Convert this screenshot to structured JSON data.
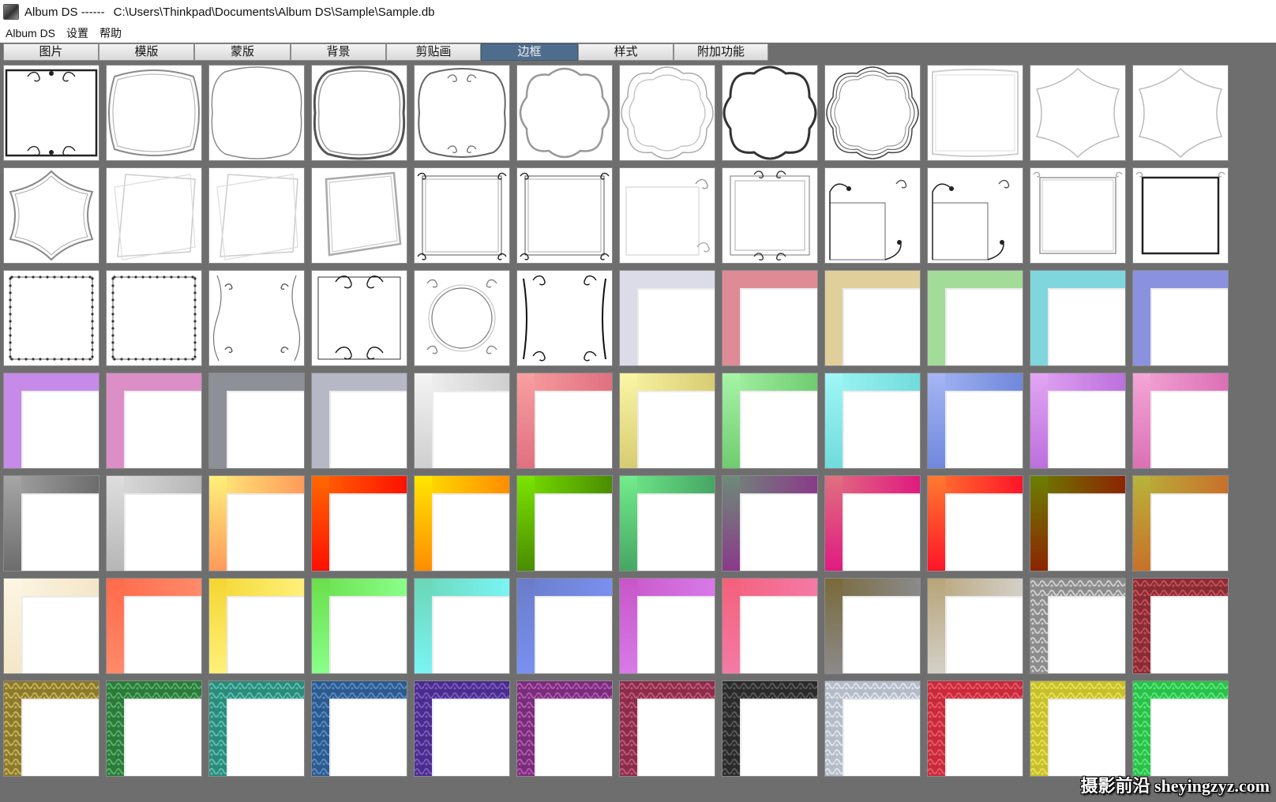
{
  "window": {
    "title": "Album DS ------",
    "path": "C:\\Users\\Thinkpad\\Documents\\Album DS\\Sample\\Sample.db",
    "icon": "album-app-icon"
  },
  "menu": [
    {
      "label": "Album DS"
    },
    {
      "label": "设置"
    },
    {
      "label": "帮助"
    }
  ],
  "tabs": [
    {
      "label": "图片"
    },
    {
      "label": "模版"
    },
    {
      "label": "蒙版"
    },
    {
      "label": "背景"
    },
    {
      "label": "剪贴画"
    },
    {
      "label": "边框"
    },
    {
      "label": "样式"
    },
    {
      "label": "附加功能"
    }
  ],
  "active_tab": 5,
  "grid": {
    "rows": 7,
    "cols": 12
  },
  "frames": [
    {
      "kind": "ornate-scroll"
    },
    {
      "kind": "scalloped-light"
    },
    {
      "kind": "arched-light"
    },
    {
      "kind": "arched-double"
    },
    {
      "kind": "arched-ornate"
    },
    {
      "kind": "cloud"
    },
    {
      "kind": "cloud-double"
    },
    {
      "kind": "cloud-bold"
    },
    {
      "kind": "cloud-triple"
    },
    {
      "kind": "plain-light"
    },
    {
      "kind": "diamond-light"
    },
    {
      "kind": "diamond-light"
    },
    {
      "kind": "diamond-double"
    },
    {
      "kind": "rotated-square"
    },
    {
      "kind": "rotated-square"
    },
    {
      "kind": "rotated-square-double"
    },
    {
      "kind": "corner-ornaments"
    },
    {
      "kind": "corner-ornaments"
    },
    {
      "kind": "corner-swirl-light"
    },
    {
      "kind": "lace-frame"
    },
    {
      "kind": "vine-box"
    },
    {
      "kind": "vine-box"
    },
    {
      "kind": "pinned-square"
    },
    {
      "kind": "pinned-square-bold"
    },
    {
      "kind": "floral-border"
    },
    {
      "kind": "floral-border-dense"
    },
    {
      "kind": "vine-sides"
    },
    {
      "kind": "baroque-bold"
    },
    {
      "kind": "circle-lace"
    },
    {
      "kind": "branch-bold"
    },
    {
      "kind": "solid-corner",
      "color": "#dcdce8"
    },
    {
      "kind": "solid-corner",
      "color": "#de8b96"
    },
    {
      "kind": "solid-corner",
      "color": "#e0cf9a"
    },
    {
      "kind": "solid-corner",
      "color": "#a2dc98"
    },
    {
      "kind": "solid-corner",
      "color": "#7fd6dc"
    },
    {
      "kind": "solid-corner",
      "color": "#8a92e0"
    },
    {
      "kind": "solid-corner",
      "color": "#c68ae8"
    },
    {
      "kind": "solid-corner",
      "color": "#dc8ec6"
    },
    {
      "kind": "solid-corner",
      "color": "#8e9098"
    },
    {
      "kind": "solid-corner",
      "color": "#b6b8c6"
    },
    {
      "kind": "gradient-corner",
      "color": "#f4f4f4",
      "color2": "#cfcfcf"
    },
    {
      "kind": "gradient-corner",
      "color": "#f8a0a0",
      "color2": "#e07080"
    },
    {
      "kind": "gradient-corner",
      "color": "#faf6a6",
      "color2": "#d8cc72"
    },
    {
      "kind": "gradient-corner",
      "color": "#a6f4a6",
      "color2": "#70cc70"
    },
    {
      "kind": "gradient-corner",
      "color": "#a0f6f6",
      "color2": "#70dcdc"
    },
    {
      "kind": "gradient-corner",
      "color": "#a6b6f4",
      "color2": "#7088dc"
    },
    {
      "kind": "gradient-corner",
      "color": "#e2a6f4",
      "color2": "#bc70dc"
    },
    {
      "kind": "gradient-corner",
      "color": "#f4a6d6",
      "color2": "#dc70b6"
    },
    {
      "kind": "gradient-corner",
      "color": "#a6a6a6",
      "color2": "#6c6c6c"
    },
    {
      "kind": "gradient-corner",
      "color": "#dedede",
      "color2": "#b6b6b6"
    },
    {
      "kind": "gradient-corner",
      "color": "#fff07a",
      "color2": "#ff9a5a"
    },
    {
      "kind": "gradient-corner",
      "color": "#ff6a00",
      "color2": "#ff1000"
    },
    {
      "kind": "gradient-corner",
      "color": "#ffe600",
      "color2": "#ff8c00"
    },
    {
      "kind": "gradient-corner",
      "color": "#7ae400",
      "color2": "#4a8c00"
    },
    {
      "kind": "gradient-corner",
      "color": "#72ec8c",
      "color2": "#46a664"
    },
    {
      "kind": "gradient-corner",
      "color": "#6e8a78",
      "color2": "#8a3a8a"
    },
    {
      "kind": "gradient-corner",
      "color": "#e07080",
      "color2": "#e01a80"
    },
    {
      "kind": "gradient-corner",
      "color": "#ff7a30",
      "color2": "#ff1428"
    },
    {
      "kind": "gradient-corner",
      "color": "#6a8000",
      "color2": "#8c2400"
    },
    {
      "kind": "gradient-corner",
      "color": "#b8b43a",
      "color2": "#c8702a"
    },
    {
      "kind": "gradient-corner",
      "color": "#fdf6e4",
      "color2": "#f4e6c8"
    },
    {
      "kind": "gradient-corner",
      "color": "#ff6a4a",
      "color2": "#ff8a6a"
    },
    {
      "kind": "gradient-corner",
      "color": "#f4d632",
      "color2": "#fff07a"
    },
    {
      "kind": "gradient-corner",
      "color": "#6ade4a",
      "color2": "#8aff8a"
    },
    {
      "kind": "gradient-corner",
      "color": "#6ad6b6",
      "color2": "#7af4f4"
    },
    {
      "kind": "gradient-corner",
      "color": "#6a7cc8",
      "color2": "#7a90f0"
    },
    {
      "kind": "gradient-corner",
      "color": "#c856c8",
      "color2": "#d87ae8"
    },
    {
      "kind": "gradient-corner",
      "color": "#f4607a",
      "color2": "#f47aa6"
    },
    {
      "kind": "gradient-corner",
      "color": "#7a6a3a",
      "color2": "#8a8a8a"
    },
    {
      "kind": "gradient-corner",
      "color": "#b8a478",
      "color2": "#d4d0c8"
    },
    {
      "kind": "texture-corner",
      "color": "#8c8c8c",
      "color2": "#cfcfcf"
    },
    {
      "kind": "texture-corner",
      "color": "#8a2c34",
      "color2": "#c4505a"
    },
    {
      "kind": "texture-corner",
      "color": "#8c7a2c",
      "color2": "#c8b25a"
    },
    {
      "kind": "texture-corner",
      "color": "#2c7a3a",
      "color2": "#5ab06a"
    },
    {
      "kind": "texture-corner",
      "color": "#2c8a7a",
      "color2": "#5ac0b0"
    },
    {
      "kind": "texture-corner",
      "color": "#2c5a8c",
      "color2": "#5a8ac4"
    },
    {
      "kind": "texture-corner",
      "color": "#4a2c8a",
      "color2": "#7a5ac4"
    },
    {
      "kind": "texture-corner",
      "color": "#7a2c7a",
      "color2": "#b05ab0"
    },
    {
      "kind": "texture-corner",
      "color": "#8a2c4a",
      "color2": "#c05a7a"
    },
    {
      "kind": "texture-corner",
      "color": "#2a2a2a",
      "color2": "#5a5a5a"
    },
    {
      "kind": "texture-corner",
      "color": "#b4bcc8",
      "color2": "#e0e4ec"
    },
    {
      "kind": "texture-corner",
      "color": "#c82a3a",
      "color2": "#e85a6a"
    },
    {
      "kind": "texture-corner",
      "color": "#c8c02a",
      "color2": "#e8e05a"
    },
    {
      "kind": "texture-corner",
      "color": "#2ac04a",
      "color2": "#5ae87a"
    }
  ],
  "watermark": "摄影前沿 sheyingzyz.com"
}
